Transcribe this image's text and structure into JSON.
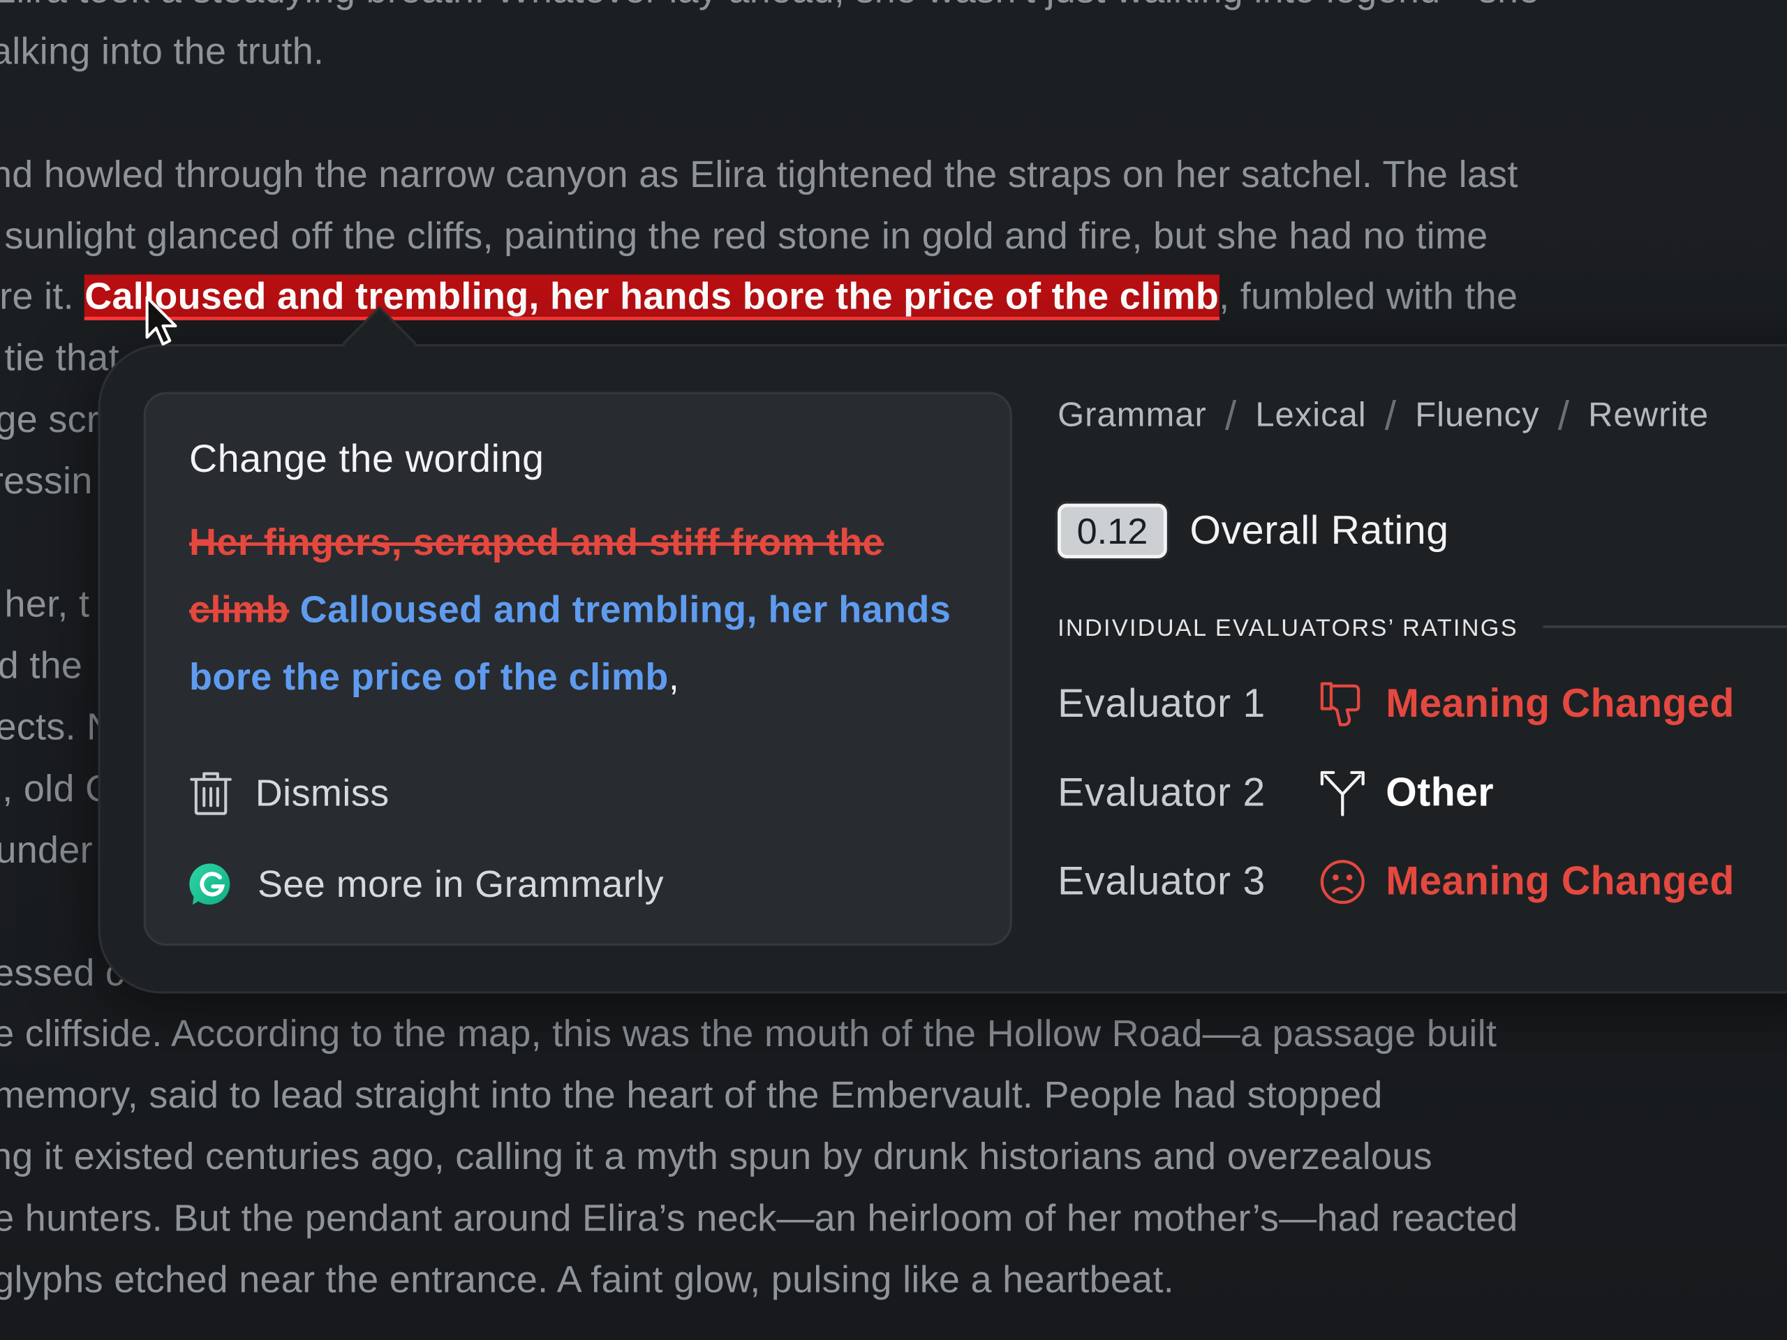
{
  "document": {
    "lines": [
      {
        "text": "Elira took a steadying breath. Whatever lay ahead, she wasn’t just walking into legend—she"
      },
      {
        "text": "alking into the truth."
      },
      {
        "text": "nd howled through the narrow canyon as Elira tightened the straps on her satchel. The last"
      },
      {
        "text": "sunlight glanced off the cliffs, painting the red stone in gold and fire, but she had no time"
      },
      {
        "pre": "ire it. ",
        "highlight": "Calloused and trembling, her hands bore the price of the climb",
        "post": ", fumbled with the"
      },
      {
        "text": "tie that"
      },
      {
        "text": "ge scr"
      },
      {
        "text": "ressin"
      },
      {
        "text": "her, t"
      },
      {
        "text": "d the"
      },
      {
        "text": "ects. N"
      },
      {
        "text": ", old C"
      },
      {
        "text": "under"
      },
      {
        "text": "essed c"
      },
      {
        "text": "e cliffside. According to the map, this was the mouth of the Hollow Road—a passage built"
      },
      {
        "text": "memory, said to lead straight into the heart of the Embervault. People had stopped"
      },
      {
        "text": "ng it existed centuries ago, calling it a myth spun by drunk historians and overzealous"
      },
      {
        "text": "e hunters. But the pendant around Elira’s neck—an heirloom of her mother’s—had reacted"
      },
      {
        "text": "glyphs etched near the entrance. A faint glow, pulsing like a heartbeat."
      }
    ]
  },
  "popup": {
    "card": {
      "title": "Change the wording",
      "removed": "Her fingers, scraped and stiff from the climb",
      "inserted": "Calloused and trembling, her hands bore the price of the climb",
      "trailing": ",",
      "dismiss_label": "Dismiss",
      "grammarly_label": "See more in Grammarly"
    },
    "tabs": [
      "Grammar",
      "Lexical",
      "Fluency",
      "Rewrite"
    ],
    "tab_separator": "/",
    "overall": {
      "score": "0.12",
      "label": "Overall Rating"
    },
    "evaluators_heading": "INDIVIDUAL EVALUATORS’ RATINGS",
    "evaluators": [
      {
        "name": "Evaluator 1",
        "icon": "thumbs-down-icon",
        "verdict": "Meaning Changed",
        "color": "#e5483f"
      },
      {
        "name": "Evaluator 2",
        "icon": "split-arrows-icon",
        "verdict": "Other",
        "color": "#ffffff"
      },
      {
        "name": "Evaluator 3",
        "icon": "sad-face-icon",
        "verdict": "Meaning Changed",
        "color": "#e5483f"
      }
    ]
  },
  "colors": {
    "highlight_bg": "#b80f12",
    "removed_text": "#e5483f",
    "inserted_text": "#5f9cf0",
    "grammarly_green": "#15c39a"
  }
}
